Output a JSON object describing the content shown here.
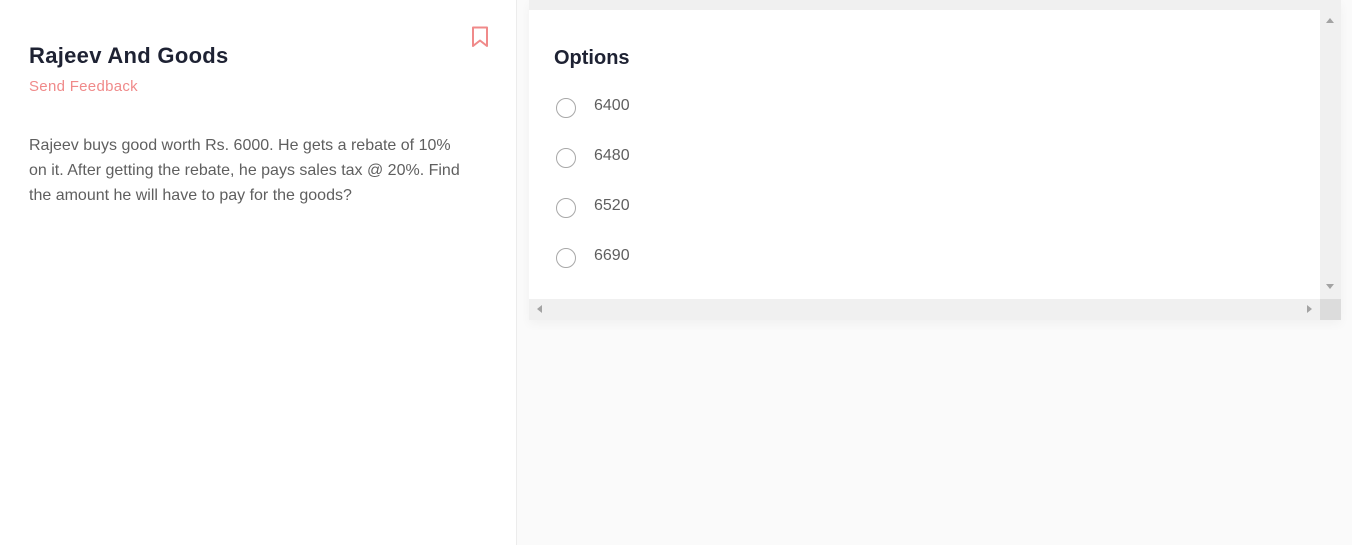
{
  "problem": {
    "title": "Rajeev And Goods",
    "feedback_label": "Send Feedback",
    "question": "Rajeev buys good worth Rs. 6000. He gets a rebate of 10% on it. After getting the rebate, he pays sales tax @ 20%. Find the amount he will have to pay for the goods?",
    "bookmark_icon": "bookmark-icon"
  },
  "options": {
    "heading": "Options",
    "items": [
      {
        "label": "6400",
        "selected": false
      },
      {
        "label": "6480",
        "selected": false
      },
      {
        "label": "6520",
        "selected": false
      },
      {
        "label": "6690",
        "selected": false
      }
    ]
  },
  "colors": {
    "accent": "#f08a8a",
    "heading": "#1e2233",
    "text": "#5f5f5f"
  }
}
